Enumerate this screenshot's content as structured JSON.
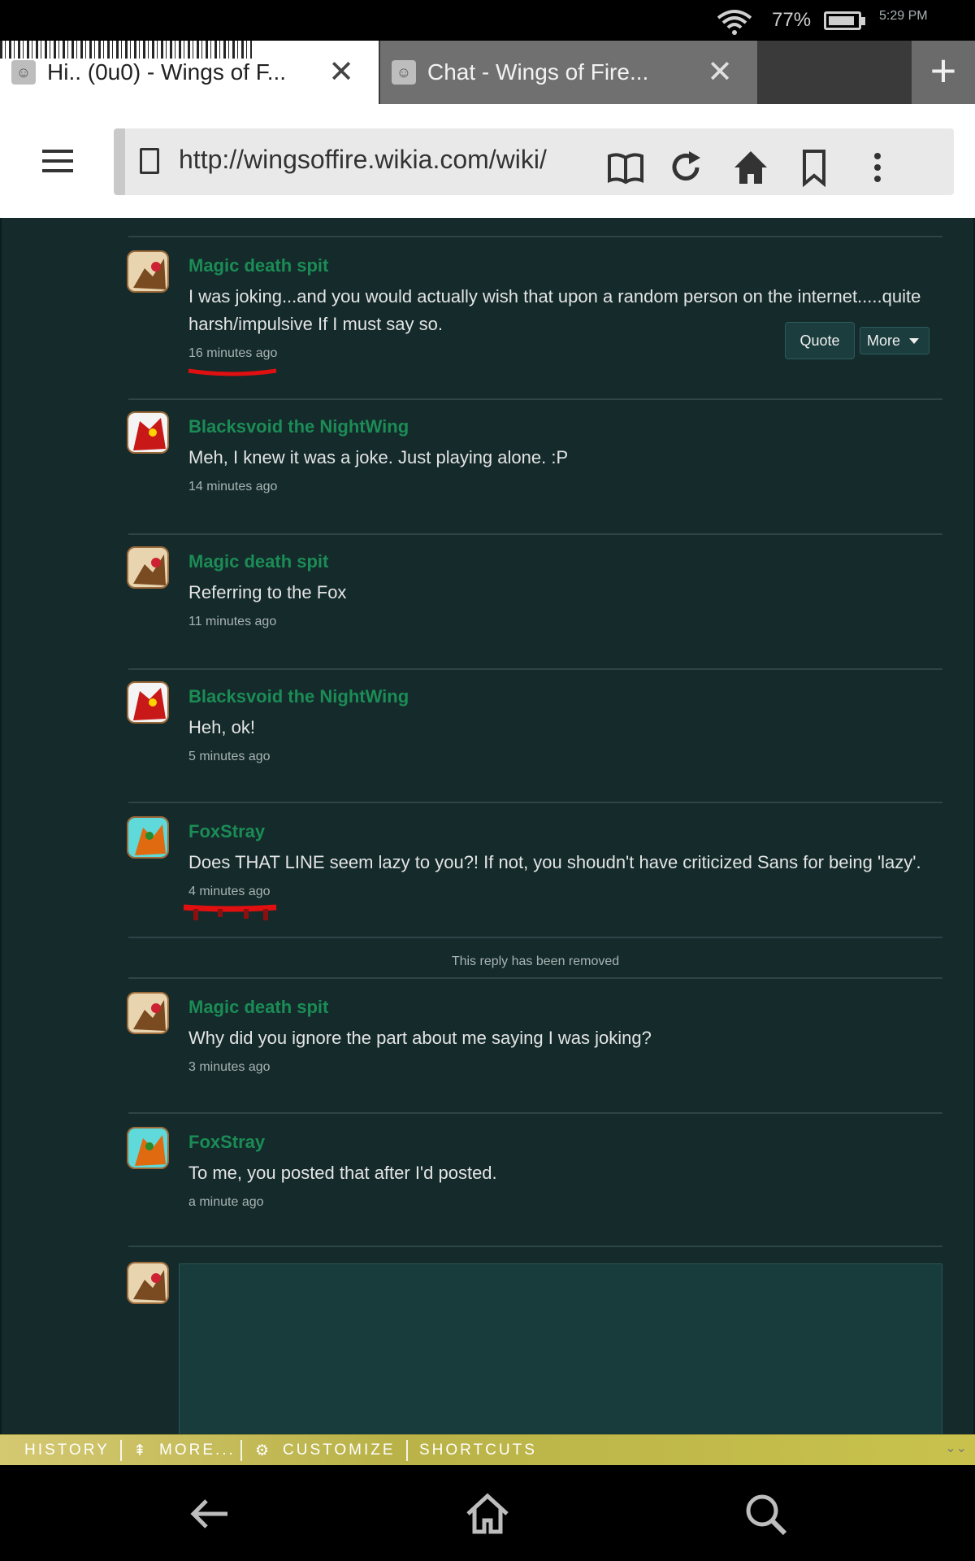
{
  "status": {
    "battery_pct": "77%",
    "battery_level": 0.77,
    "time": "5:29 PM"
  },
  "tabs": [
    {
      "title": "Hi.. (0u0) - Wings of F...",
      "active": true
    },
    {
      "title": "Chat - Wings of Fire...",
      "active": false
    }
  ],
  "toolbar": {
    "url": "http://wingsoffire.wikia.com/wiki/"
  },
  "messages": [
    {
      "author": "Magic death spit",
      "body": "I was joking...and you would actually wish that upon a random person on the internet.....quite harsh/impulsive If I must say so.",
      "time": "16 minutes ago",
      "avatar": "magic"
    },
    {
      "author": "Blacksvoid the NightWing",
      "body": "Meh, I knew it was a joke. Just playing alone. :P",
      "time": "14 minutes ago",
      "avatar": "black"
    },
    {
      "author": "Magic death spit",
      "body": "Referring to the Fox",
      "time": "11 minutes ago",
      "avatar": "magic"
    },
    {
      "author": "Blacksvoid the NightWing",
      "body": "Heh, ok!",
      "time": "5 minutes ago",
      "avatar": "black"
    },
    {
      "author": "FoxStray",
      "body": "Does THAT LINE seem lazy to you?! If not, you shoudn't have criticized Sans for being 'lazy'.",
      "time": "4 minutes ago",
      "avatar": "fox"
    },
    {
      "author": "Magic death spit",
      "body": "Why did you ignore the part about me saying I was joking?",
      "time": "3 minutes ago",
      "avatar": "magic"
    },
    {
      "author": "FoxStray",
      "body": "To me, you posted that after I'd posted.",
      "time": "a minute ago",
      "avatar": "fox"
    }
  ],
  "actions": {
    "quote": "Quote",
    "more": "More"
  },
  "removed_notice": "This reply has been removed",
  "shortcuts": {
    "history": "HISTORY",
    "more": "MORE...",
    "customize": "CUSTOMIZE",
    "shortcuts": "SHORTCUTS"
  }
}
